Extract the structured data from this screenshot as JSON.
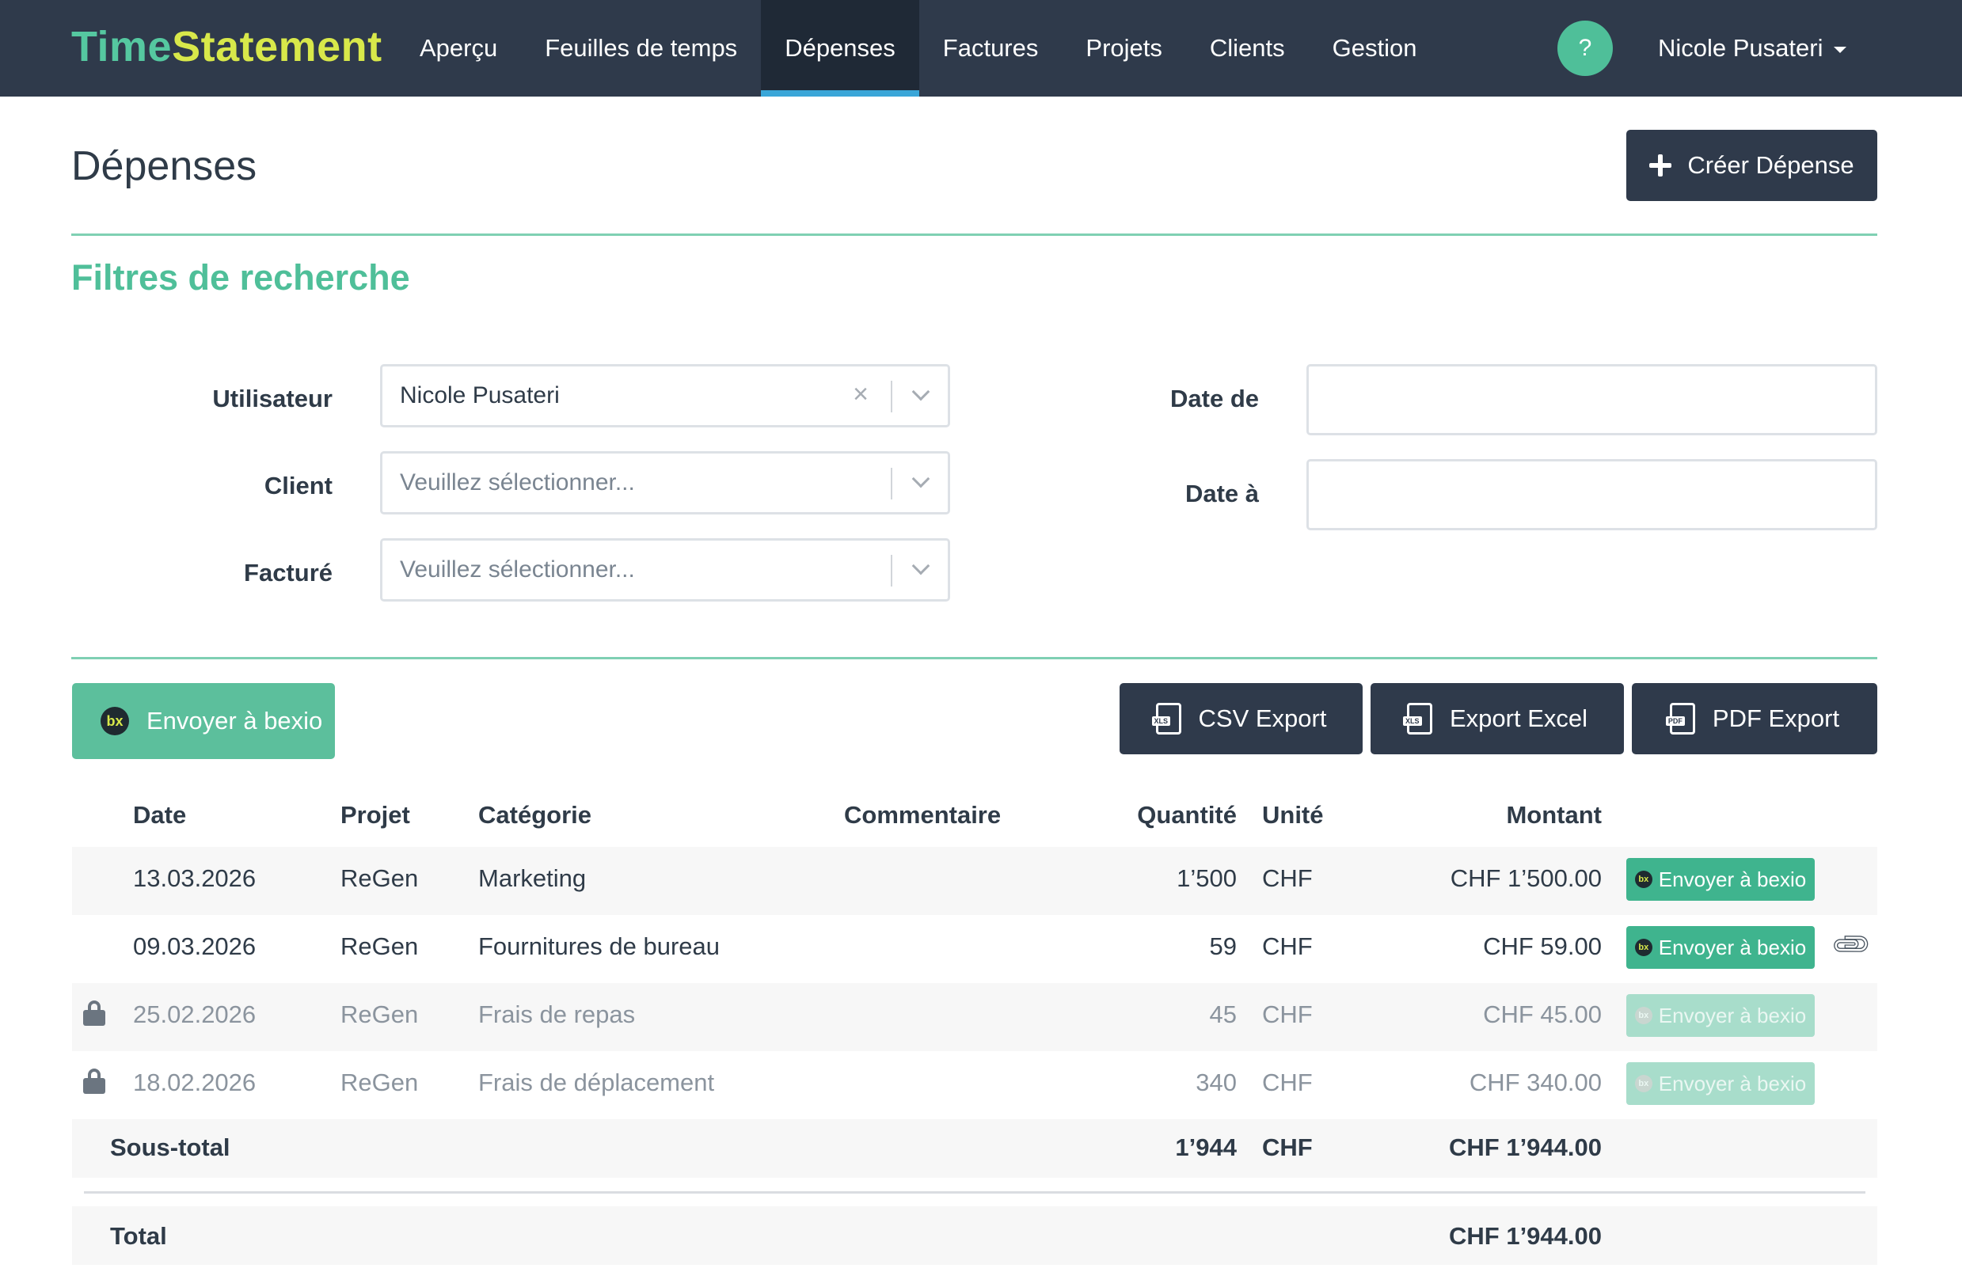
{
  "app": {
    "brand_part1": "Time",
    "brand_part2": "Statement",
    "nav": [
      "Aperçu",
      "Feuilles de temps",
      "Dépenses",
      "Factures",
      "Projets",
      "Clients",
      "Gestion"
    ],
    "active_nav": "Dépenses",
    "help_label": "?",
    "user_name": "Nicole Pusateri"
  },
  "page": {
    "title": "Dépenses",
    "create_button": "Créer Dépense"
  },
  "filters": {
    "title": "Filtres de recherche",
    "user_label": "Utilisateur",
    "user_value": "Nicole Pusateri",
    "client_label": "Client",
    "client_placeholder": "Veuillez sélectionner...",
    "invoiced_label": "Facturé",
    "invoiced_placeholder": "Veuillez sélectionner...",
    "date_from_label": "Date de",
    "date_to_label": "Date à",
    "date_from_value": "",
    "date_to_value": ""
  },
  "actions": {
    "bexio_button": "Envoyer à bexio",
    "bexio_logo": "bx",
    "csv_export": "CSV Export",
    "excel_export": "Export Excel",
    "pdf_export": "PDF Export",
    "xls_tag": "XLS",
    "pdf_tag": "PDF"
  },
  "table": {
    "headers": {
      "date": "Date",
      "project": "Projet",
      "category": "Catégorie",
      "comment": "Commentaire",
      "quantity": "Quantité",
      "unit": "Unité",
      "amount": "Montant"
    },
    "rows": [
      {
        "date": "13.03.2026",
        "project": "ReGen",
        "category": "Marketing",
        "comment": "",
        "quantity": "1’500",
        "unit": "CHF",
        "amount": "CHF 1’500.00",
        "action": "Envoyer à bexio",
        "locked": false,
        "attachment": false
      },
      {
        "date": "09.03.2026",
        "project": "ReGen",
        "category": "Fournitures de bureau",
        "comment": "",
        "quantity": "59",
        "unit": "CHF",
        "amount": "CHF 59.00",
        "action": "Envoyer à bexio",
        "locked": false,
        "attachment": true
      },
      {
        "date": "25.02.2026",
        "project": "ReGen",
        "category": "Frais de repas",
        "comment": "",
        "quantity": "45",
        "unit": "CHF",
        "amount": "CHF 45.00",
        "action": "Envoyer à bexio",
        "locked": true,
        "attachment": false
      },
      {
        "date": "18.02.2026",
        "project": "ReGen",
        "category": "Frais de déplacement",
        "comment": "",
        "quantity": "340",
        "unit": "CHF",
        "amount": "CHF 340.00",
        "action": "Envoyer à bexio",
        "locked": true,
        "attachment": false
      }
    ],
    "subtotal": {
      "label": "Sous-total",
      "quantity": "1’944",
      "unit": "CHF",
      "amount": "CHF 1’944.00"
    },
    "total": {
      "label": "Total",
      "amount": "CHF 1’944.00"
    }
  },
  "colors": {
    "nav_bg": "#2f3a4b",
    "accent_green": "#4fbf99",
    "brand_yellow": "#d8e84a",
    "active_tab_underline": "#3aa6d8"
  }
}
